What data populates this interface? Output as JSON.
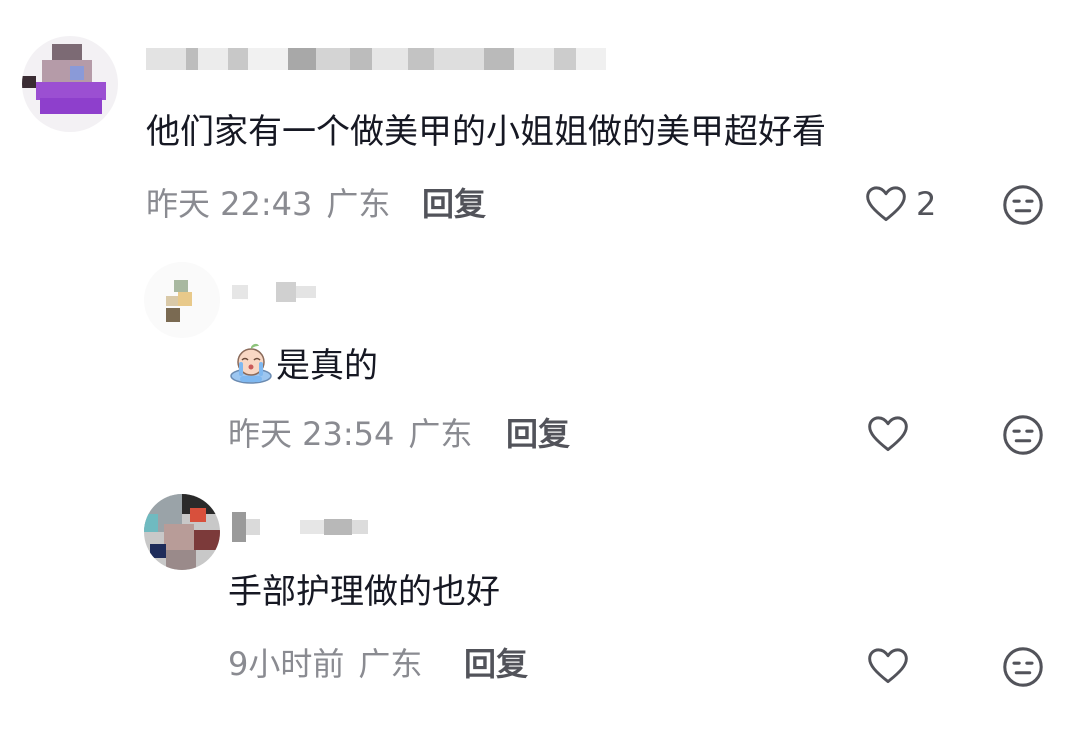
{
  "comments": [
    {
      "text": "他们家有一个做美甲的小姐姐做的美甲超好看",
      "time": "昨天 22:43",
      "location": "广东",
      "reply_label": "回复",
      "like_count": "2"
    },
    {
      "text": "是真的",
      "time": "昨天 23:54",
      "location": "广东",
      "reply_label": "回复",
      "like_count": ""
    },
    {
      "text": "手部护理做的也好",
      "time": "9小时前",
      "location": "广东",
      "reply_label": "回复",
      "like_count": ""
    }
  ],
  "icons": {
    "like": "heart-outline-icon",
    "dislike": "neutral-face-icon",
    "reply_emoji": "crying-emoji-icon"
  },
  "colors": {
    "text": "#161823",
    "meta": "#8a8b91",
    "reply": "#52535a",
    "icon": "#52535a"
  }
}
